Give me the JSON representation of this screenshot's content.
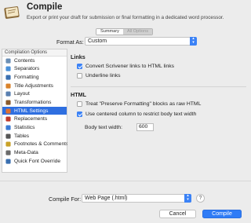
{
  "header": {
    "title": "Compile",
    "subtitle": "Export or print your draft for submission or final formatting in a dedicated word processor."
  },
  "tabs": [
    {
      "label": "Summary",
      "active": true
    },
    {
      "label": "All Options",
      "active": false
    }
  ],
  "format": {
    "label": "Format As:",
    "value": "Custom"
  },
  "sidebar": {
    "header": "Compilation Options",
    "selected_index": 7,
    "items": [
      {
        "label": "Contents",
        "icon": "contents-icon"
      },
      {
        "label": "Separators",
        "icon": "separators-icon"
      },
      {
        "label": "Formatting",
        "icon": "formatting-icon"
      },
      {
        "label": "Title Adjustments",
        "icon": "title-adjustments-icon"
      },
      {
        "label": "Layout",
        "icon": "layout-icon"
      },
      {
        "label": "Transformations",
        "icon": "transformations-icon"
      },
      {
        "label": "HTML Settings",
        "icon": "html-settings-icon"
      },
      {
        "label": "Replacements",
        "icon": "replacements-icon"
      },
      {
        "label": "Statistics",
        "icon": "statistics-icon"
      },
      {
        "label": "Tables",
        "icon": "tables-icon"
      },
      {
        "label": "Footnotes & Comments",
        "icon": "footnotes-icon"
      },
      {
        "label": "Meta-Data",
        "icon": "meta-data-icon"
      },
      {
        "label": "Quick Font Override",
        "icon": "quick-font-icon"
      }
    ]
  },
  "links_section": {
    "title": "Links",
    "options": [
      {
        "label": "Convert Scrivener links to HTML links",
        "checked": true
      },
      {
        "label": "Underline links",
        "checked": false
      }
    ]
  },
  "html_section": {
    "title": "HTML",
    "options": [
      {
        "label": "Treat \"Preserve Formatting\" blocks as raw HTML",
        "checked": false
      },
      {
        "label": "Use centered column to restrict body text width",
        "checked": true
      }
    ],
    "body_width_label": "Body text width:",
    "body_width_value": "600"
  },
  "footer": {
    "compile_for_label": "Compile For:",
    "compile_for_value": "Web Page (.html)",
    "help_label": "?",
    "cancel_label": "Cancel",
    "compile_label": "Compile"
  },
  "colors": {
    "accent": "#2f7cf6",
    "selection": "#2f6fe0"
  }
}
